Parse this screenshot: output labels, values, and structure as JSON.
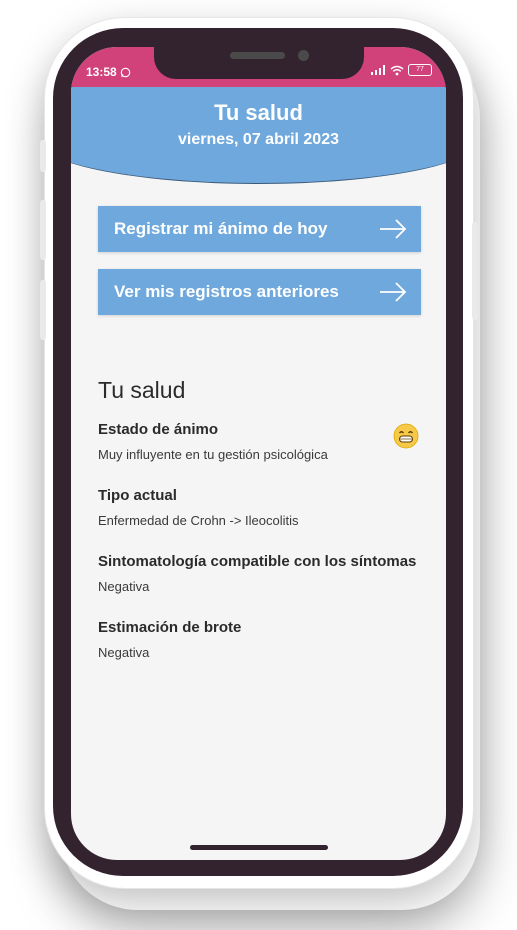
{
  "status_bar": {
    "time": "13:58",
    "battery": "77"
  },
  "header": {
    "title": "Tu salud",
    "date": "viernes, 07 abril 2023"
  },
  "actions": [
    {
      "label": "Registrar mi ánimo de hoy"
    },
    {
      "label": "Ver mis registros anteriores"
    }
  ],
  "health": {
    "section_title": "Tu salud",
    "items": [
      {
        "title": "Estado de ánimo",
        "value": "Muy influyente en tu gestión psicológica",
        "icon": "grinning-face-emoji"
      },
      {
        "title": "Tipo actual",
        "value": "Enfermedad de Crohn -> Ileocolitis"
      },
      {
        "title": "Sintomatología compatible con los síntomas",
        "value": "Negativa"
      },
      {
        "title": "Estimación de brote",
        "value": "Negativa"
      }
    ]
  },
  "colors": {
    "status_bar": "#d1427a",
    "accent": "#6fa8dc",
    "frame": "#33232e",
    "background": "#f5f5f5"
  }
}
